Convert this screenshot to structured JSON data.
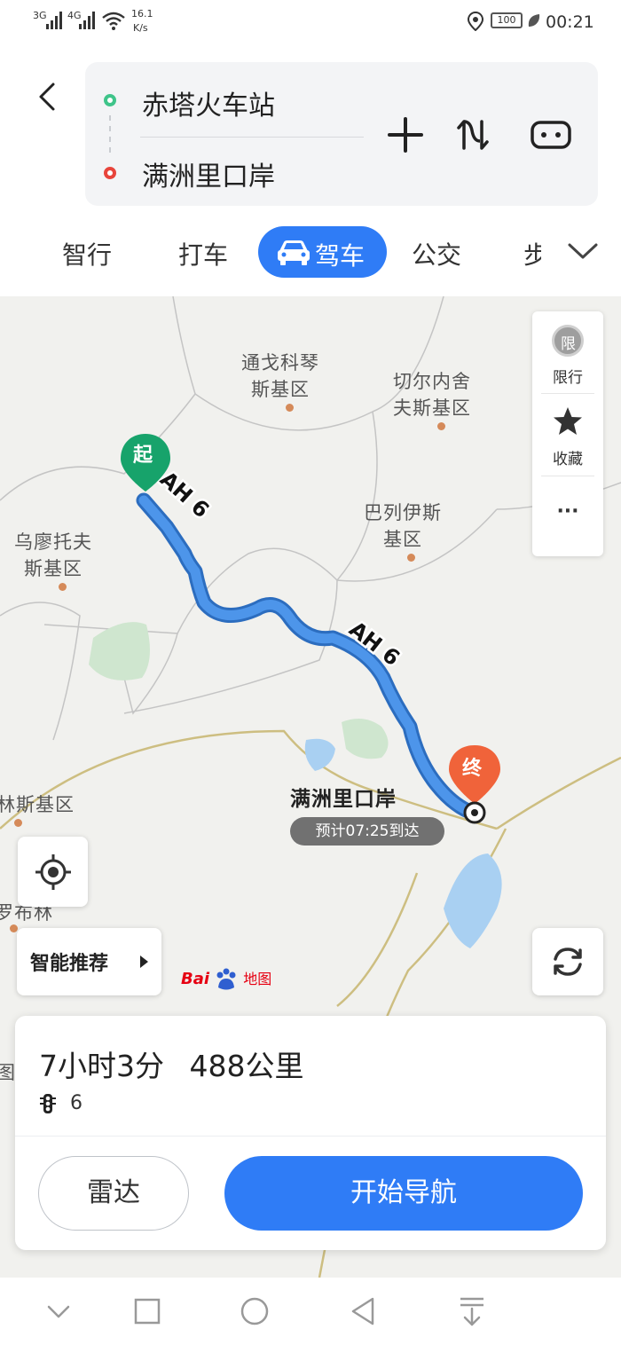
{
  "status_bar": {
    "network1": "3G",
    "network2": "4G",
    "speed_value": "16.1",
    "speed_unit": "K/s",
    "battery": "100",
    "time": "00:21",
    "icons": [
      "signal-icon",
      "wifi-icon",
      "location-icon",
      "battery-icon",
      "leaf-icon"
    ]
  },
  "header": {
    "start": "赤塔火车站",
    "end": "满洲里口岸",
    "colors": {
      "start_dot": "#3fc48a",
      "end_dot": "#e8453c"
    },
    "icons": [
      "back-icon",
      "add-icon",
      "swap-icon",
      "settings-icon"
    ]
  },
  "tabs": [
    {
      "label": "智行"
    },
    {
      "label": "打车"
    },
    {
      "label": "驾车",
      "active": true
    },
    {
      "label": "公交"
    },
    {
      "label": "步"
    }
  ],
  "map": {
    "labels": {
      "tongge": "通戈科琴\n斯基区",
      "qieer": "切尔内舍\n夫斯基区",
      "bali": "巴列伊斯\n基区",
      "wuliao": "乌廖托夫\n斯基区",
      "linsi": "林斯基区",
      "luobu": "罗布林",
      "tu": "图"
    },
    "route_shield": "AH 6",
    "start_marker": "起",
    "end_marker": "终",
    "destination": "满洲里口岸",
    "eta": "预计07:25到达",
    "logo_text_a": "Bai",
    "logo_text_b": "地图",
    "colors": {
      "route": "#4d95ea",
      "start_pin": "#17a36b",
      "end_pin": "#f0633a",
      "water": "#a9d0f2",
      "park": "#cfe6cf"
    }
  },
  "side_panel": {
    "restrict_badge": "限",
    "restrict": "限行",
    "favorite": "收藏",
    "more": "···"
  },
  "smart_rec": "智能推荐",
  "route_card": {
    "duration": "7小时3分",
    "distance": "488公里",
    "lights": "6",
    "radar": "雷达",
    "start_nav": "开始导航"
  }
}
